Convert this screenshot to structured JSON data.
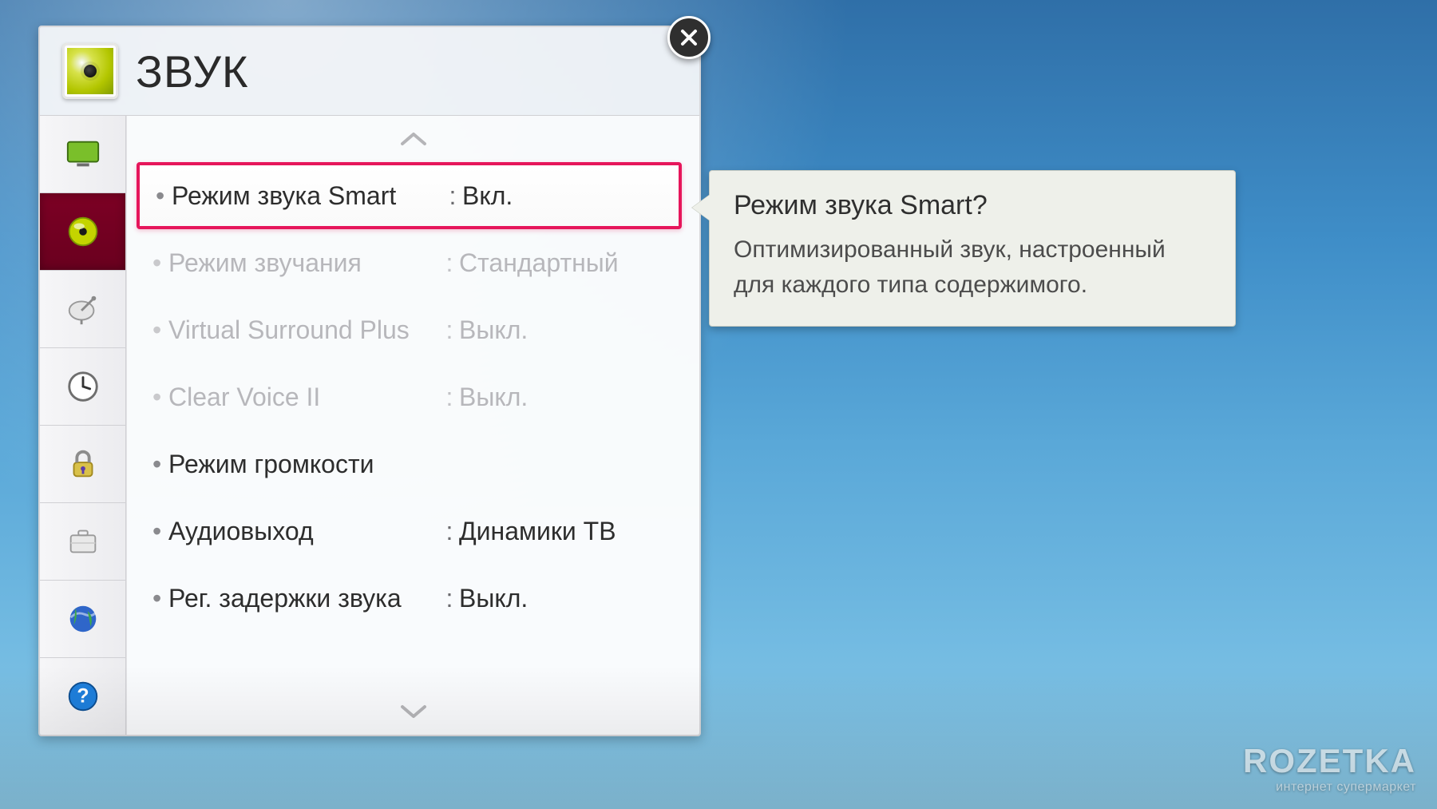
{
  "window": {
    "title": "ЗВУК"
  },
  "sidebar": {
    "items": [
      {
        "key": "screen",
        "icon": "screen"
      },
      {
        "key": "sound",
        "icon": "sound",
        "selected": true
      },
      {
        "key": "channel",
        "icon": "dish"
      },
      {
        "key": "time",
        "icon": "clock"
      },
      {
        "key": "lock",
        "icon": "lock"
      },
      {
        "key": "general",
        "icon": "case"
      },
      {
        "key": "network",
        "icon": "globe"
      },
      {
        "key": "help",
        "icon": "help"
      }
    ]
  },
  "list": {
    "items": [
      {
        "label": "Режим звука Smart",
        "value": "Вкл.",
        "selected": true
      },
      {
        "label": "Режим звучания",
        "value": "Стандартный",
        "disabled": true
      },
      {
        "label": "Virtual Surround Plus",
        "value": "Выкл.",
        "disabled": true
      },
      {
        "label": "Clear Voice II",
        "value": "Выкл.",
        "disabled": true
      },
      {
        "label": "Режим громкости",
        "value": ""
      },
      {
        "label": "Аудиовыход",
        "value": "Динамики ТВ"
      },
      {
        "label": "Рег. задержки звука",
        "value": "Выкл."
      }
    ]
  },
  "tooltip": {
    "title": "Режим звука Smart?",
    "body": "Оптимизированный звук, настроенный для каждого типа содержимого."
  },
  "watermark": {
    "main": "ROZETKA",
    "sub": "интернет супермаркет"
  }
}
